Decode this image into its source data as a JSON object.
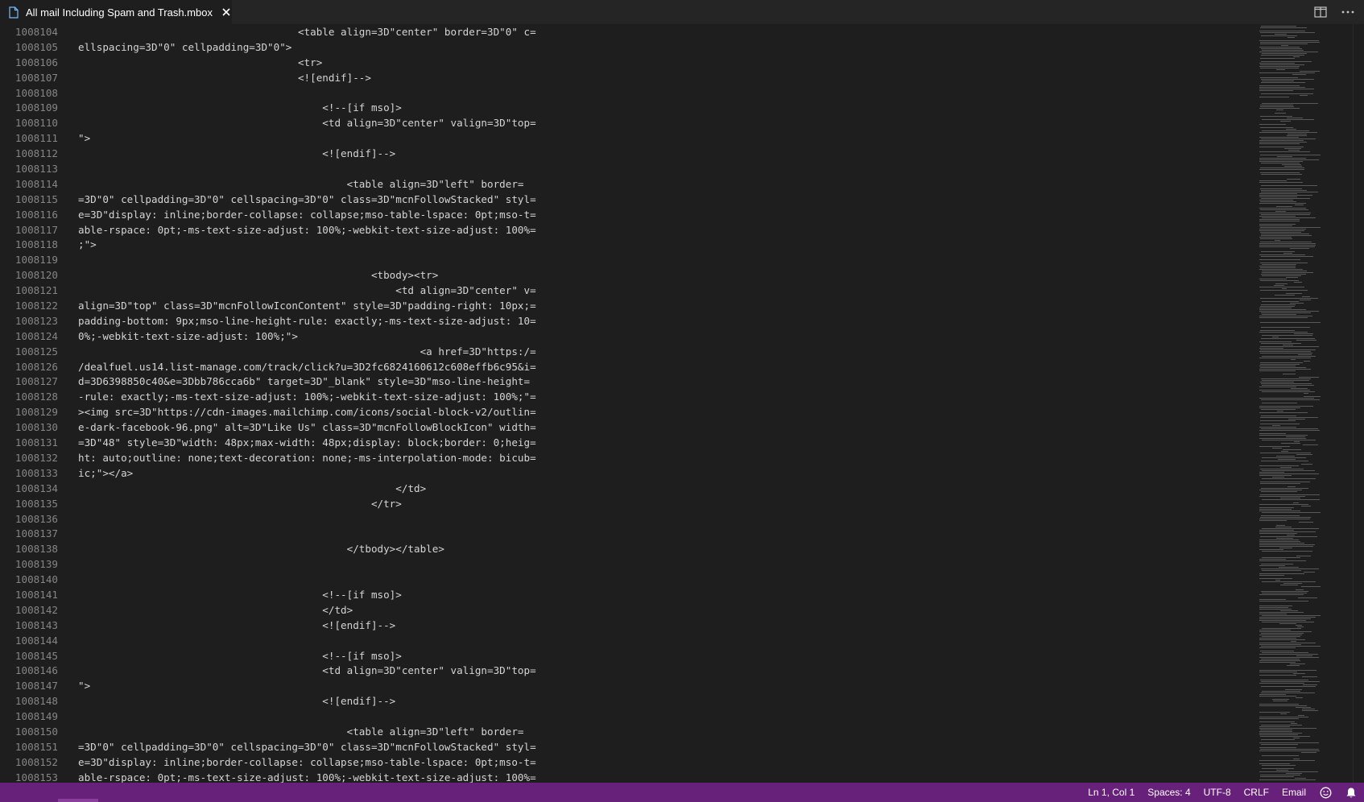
{
  "tab": {
    "label": "All mail Including Spam and Trash.mbox",
    "icon": "file-icon",
    "close_icon": "close-icon"
  },
  "tab_actions": [
    {
      "icon": "split-editor-icon"
    },
    {
      "icon": "more-actions-icon"
    }
  ],
  "editor": {
    "lines": [
      {
        "num": "1008104",
        "text": "                                    <table align=3D\"center\" border=3D\"0\" c="
      },
      {
        "num": "1008105",
        "text": "ellspacing=3D\"0\" cellpadding=3D\"0\">"
      },
      {
        "num": "1008106",
        "text": "                                    <tr>"
      },
      {
        "num": "1008107",
        "text": "                                    <![endif]-->"
      },
      {
        "num": "1008108",
        "text": ""
      },
      {
        "num": "1008109",
        "text": "                                        <!--[if mso]>"
      },
      {
        "num": "1008110",
        "text": "                                        <td align=3D\"center\" valign=3D\"top="
      },
      {
        "num": "1008111",
        "text": "\">"
      },
      {
        "num": "1008112",
        "text": "                                        <![endif]-->"
      },
      {
        "num": "1008113",
        "text": ""
      },
      {
        "num": "1008114",
        "text": "                                            <table align=3D\"left\" border="
      },
      {
        "num": "1008115",
        "text": "=3D\"0\" cellpadding=3D\"0\" cellspacing=3D\"0\" class=3D\"mcnFollowStacked\" styl="
      },
      {
        "num": "1008116",
        "text": "e=3D\"display: inline;border-collapse: collapse;mso-table-lspace: 0pt;mso-t="
      },
      {
        "num": "1008117",
        "text": "able-rspace: 0pt;-ms-text-size-adjust: 100%;-webkit-text-size-adjust: 100%="
      },
      {
        "num": "1008118",
        "text": ";\">"
      },
      {
        "num": "1008119",
        "text": ""
      },
      {
        "num": "1008120",
        "text": "                                                <tbody><tr>"
      },
      {
        "num": "1008121",
        "text": "                                                    <td align=3D\"center\" v="
      },
      {
        "num": "1008122",
        "text": "align=3D\"top\" class=3D\"mcnFollowIconContent\" style=3D\"padding-right: 10px;="
      },
      {
        "num": "1008123",
        "text": "padding-bottom: 9px;mso-line-height-rule: exactly;-ms-text-size-adjust: 10="
      },
      {
        "num": "1008124",
        "text": "0%;-webkit-text-size-adjust: 100%;\">"
      },
      {
        "num": "1008125",
        "text": "                                                        <a href=3D\"https:/="
      },
      {
        "num": "1008126",
        "text": "/dealfuel.us14.list-manage.com/track/click?u=3D2fc6824160612c608effb6c95&i="
      },
      {
        "num": "1008127",
        "text": "d=3D6398850c40&e=3Dbb786cca6b\" target=3D\"_blank\" style=3D\"mso-line-height="
      },
      {
        "num": "1008128",
        "text": "-rule: exactly;-ms-text-size-adjust: 100%;-webkit-text-size-adjust: 100%;\"="
      },
      {
        "num": "1008129",
        "text": "><img src=3D\"https://cdn-images.mailchimp.com/icons/social-block-v2/outlin="
      },
      {
        "num": "1008130",
        "text": "e-dark-facebook-96.png\" alt=3D\"Like Us\" class=3D\"mcnFollowBlockIcon\" width="
      },
      {
        "num": "1008131",
        "text": "=3D\"48\" style=3D\"width: 48px;max-width: 48px;display: block;border: 0;heig="
      },
      {
        "num": "1008132",
        "text": "ht: auto;outline: none;text-decoration: none;-ms-interpolation-mode: bicub="
      },
      {
        "num": "1008133",
        "text": "ic;\"></a>"
      },
      {
        "num": "1008134",
        "text": "                                                    </td>"
      },
      {
        "num": "1008135",
        "text": "                                                </tr>"
      },
      {
        "num": "1008136",
        "text": ""
      },
      {
        "num": "1008137",
        "text": ""
      },
      {
        "num": "1008138",
        "text": "                                            </tbody></table>"
      },
      {
        "num": "1008139",
        "text": ""
      },
      {
        "num": "1008140",
        "text": ""
      },
      {
        "num": "1008141",
        "text": "                                        <!--[if mso]>"
      },
      {
        "num": "1008142",
        "text": "                                        </td>"
      },
      {
        "num": "1008143",
        "text": "                                        <![endif]-->"
      },
      {
        "num": "1008144",
        "text": ""
      },
      {
        "num": "1008145",
        "text": "                                        <!--[if mso]>"
      },
      {
        "num": "1008146",
        "text": "                                        <td align=3D\"center\" valign=3D\"top="
      },
      {
        "num": "1008147",
        "text": "\">"
      },
      {
        "num": "1008148",
        "text": "                                        <![endif]-->"
      },
      {
        "num": "1008149",
        "text": ""
      },
      {
        "num": "1008150",
        "text": "                                            <table align=3D\"left\" border="
      },
      {
        "num": "1008151",
        "text": "=3D\"0\" cellpadding=3D\"0\" cellspacing=3D\"0\" class=3D\"mcnFollowStacked\" styl="
      },
      {
        "num": "1008152",
        "text": "e=3D\"display: inline;border-collapse: collapse;mso-table-lspace: 0pt;mso-t="
      },
      {
        "num": "1008153",
        "text": "able-rspace: 0pt;-ms-text-size-adjust: 100%;-webkit-text-size-adjust: 100%="
      }
    ]
  },
  "statusbar": {
    "position": "Ln 1, Col 1",
    "spaces": "Spaces: 4",
    "encoding": "UTF-8",
    "eol": "CRLF",
    "language": "Email",
    "feedback_icon": "smiley-icon",
    "notification_icon": "bell-icon"
  },
  "colors": {
    "editor_bg": "#1e1e1e",
    "tab_bar_bg": "#252526",
    "status_bar_bg": "#68217a",
    "line_number": "#858585",
    "text": "#d4d4d4"
  }
}
